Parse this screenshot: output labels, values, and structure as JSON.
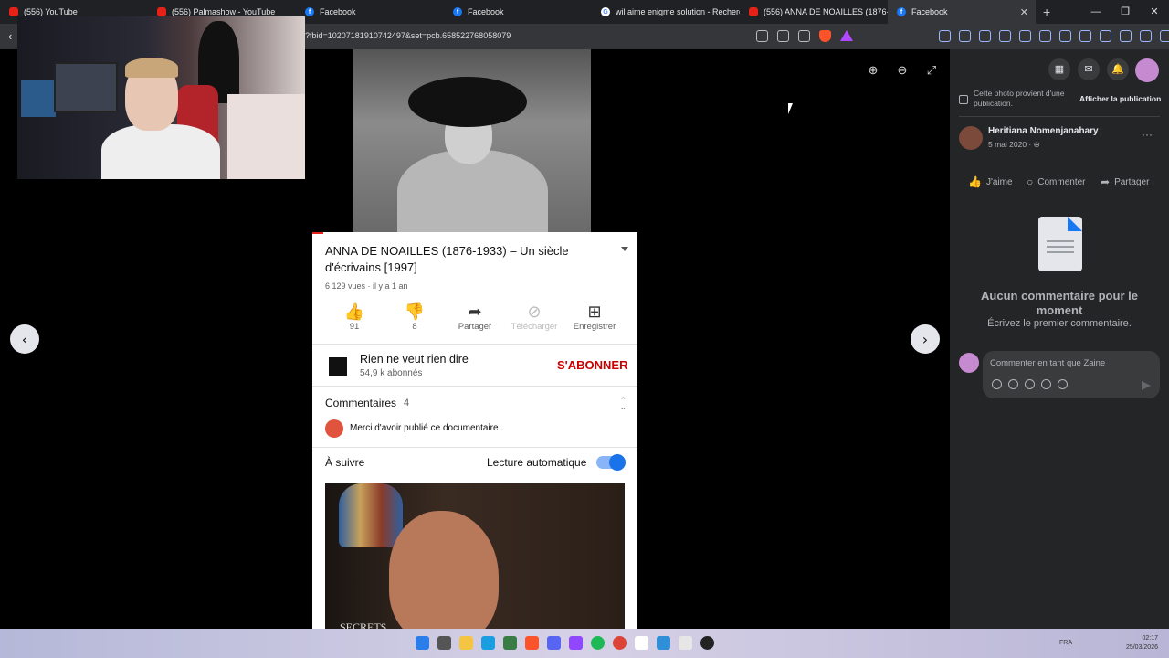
{
  "browser": {
    "tabs": [
      {
        "title": "(556) YouTube",
        "icon": "youtube-icon",
        "active": false
      },
      {
        "title": "(556) Palmashow - YouTube",
        "icon": "youtube-icon",
        "active": false
      },
      {
        "title": "Facebook",
        "icon": "facebook-icon",
        "active": false
      },
      {
        "title": "Facebook",
        "icon": "facebook-icon",
        "active": false
      },
      {
        "title": "wil aime enigme solution - Recherch",
        "icon": "google-icon",
        "active": false
      },
      {
        "title": "(556) ANNA DE NOAILLES (1876-",
        "icon": "youtube-icon",
        "active": false
      },
      {
        "title": "Facebook",
        "icon": "facebook-icon",
        "active": true
      }
    ],
    "url_visible": "?fbid=10207181910742497&set=pcb.658522768058079",
    "new_tab_label": "+",
    "window_controls": [
      "—",
      "❐",
      "✕"
    ]
  },
  "viewer": {
    "prev_label": "‹",
    "next_label": "›"
  },
  "youtube_screenshot": {
    "video_title": "ANNA DE NOAILLES (1876-1933) – Un siècle d'écrivains [1997]",
    "meta": "6 129 vues · il y a 1 an",
    "actions": [
      {
        "label": "91",
        "icon": "thumbs-up-icon"
      },
      {
        "label": "8",
        "icon": "thumbs-down-icon"
      },
      {
        "label": "Partager",
        "icon": "share-icon"
      },
      {
        "label": "Télécharger",
        "icon": "download-icon"
      },
      {
        "label": "Enregistrer",
        "icon": "add-to-playlist-icon"
      }
    ],
    "channel_name": "Rien ne veut rien dire",
    "channel_subs": "54,9 k abonnés",
    "subscribe_label": "S'ABONNER",
    "comments_label": "Commentaires",
    "comments_count": "4",
    "top_comment": "Merci d'avoir publié ce documentaire..",
    "up_next_label": "À suivre",
    "autoplay_label": "Lecture automatique",
    "autoplay_on": true,
    "thumbnail_watermark": "SECRETS"
  },
  "facebook_sidebar": {
    "post_note": "Cette photo provient d'une publication.",
    "show_post_label": "Afficher la publication",
    "author_name": "Heritiana Nomenjanahary",
    "post_date": "5 mai 2020 · ",
    "more_label": "···",
    "reactions": [
      {
        "label": "J'aime",
        "icon": "like-icon"
      },
      {
        "label": "Commenter",
        "icon": "comment-icon"
      },
      {
        "label": "Partager",
        "icon": "share-icon"
      }
    ],
    "empty_title": "Aucun commentaire pour le moment",
    "empty_subtitle": "Écrivez le premier commentaire.",
    "comment_placeholder": "Commenter en tant que Zaine"
  },
  "taskbar": {
    "language": "FRA",
    "time": "02:17",
    "date": "25/03/2026"
  },
  "colors": {
    "facebook_panel": "#242526",
    "subscribe_red": "#cc0000",
    "toggle_blue": "#1a73e8"
  }
}
